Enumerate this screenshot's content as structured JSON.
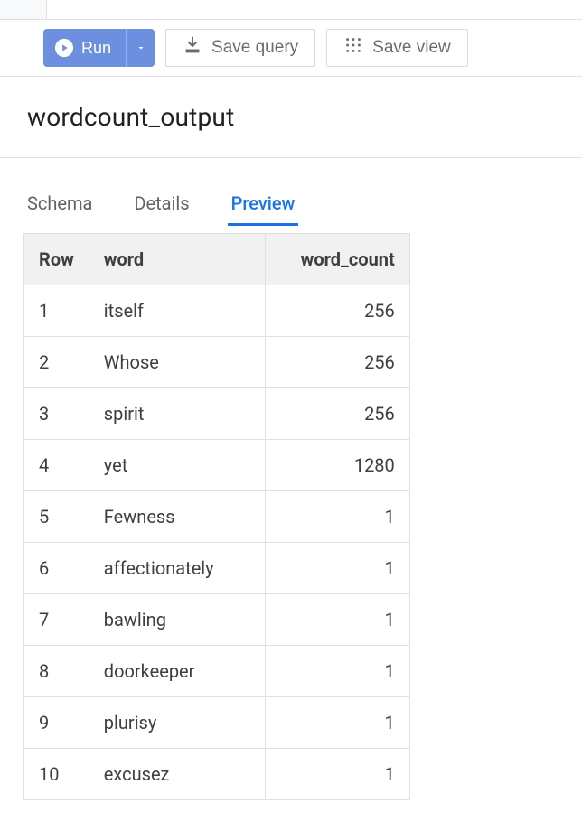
{
  "toolbar": {
    "run_label": "Run",
    "save_query_label": "Save query",
    "save_view_label": "Save view"
  },
  "title": "wordcount_output",
  "tabs": [
    {
      "label": "Schema",
      "active": false
    },
    {
      "label": "Details",
      "active": false
    },
    {
      "label": "Preview",
      "active": true
    }
  ],
  "table": {
    "headers": {
      "row": "Row",
      "word": "word",
      "word_count": "word_count"
    },
    "rows": [
      {
        "row": "1",
        "word": "itself",
        "word_count": "256"
      },
      {
        "row": "2",
        "word": "Whose",
        "word_count": "256"
      },
      {
        "row": "3",
        "word": "spirit",
        "word_count": "256"
      },
      {
        "row": "4",
        "word": "yet",
        "word_count": "1280"
      },
      {
        "row": "5",
        "word": "Fewness",
        "word_count": "1"
      },
      {
        "row": "6",
        "word": "affectionately",
        "word_count": "1"
      },
      {
        "row": "7",
        "word": "bawling",
        "word_count": "1"
      },
      {
        "row": "8",
        "word": "doorkeeper",
        "word_count": "1"
      },
      {
        "row": "9",
        "word": "plurisy",
        "word_count": "1"
      },
      {
        "row": "10",
        "word": "excusez",
        "word_count": "1"
      }
    ]
  }
}
